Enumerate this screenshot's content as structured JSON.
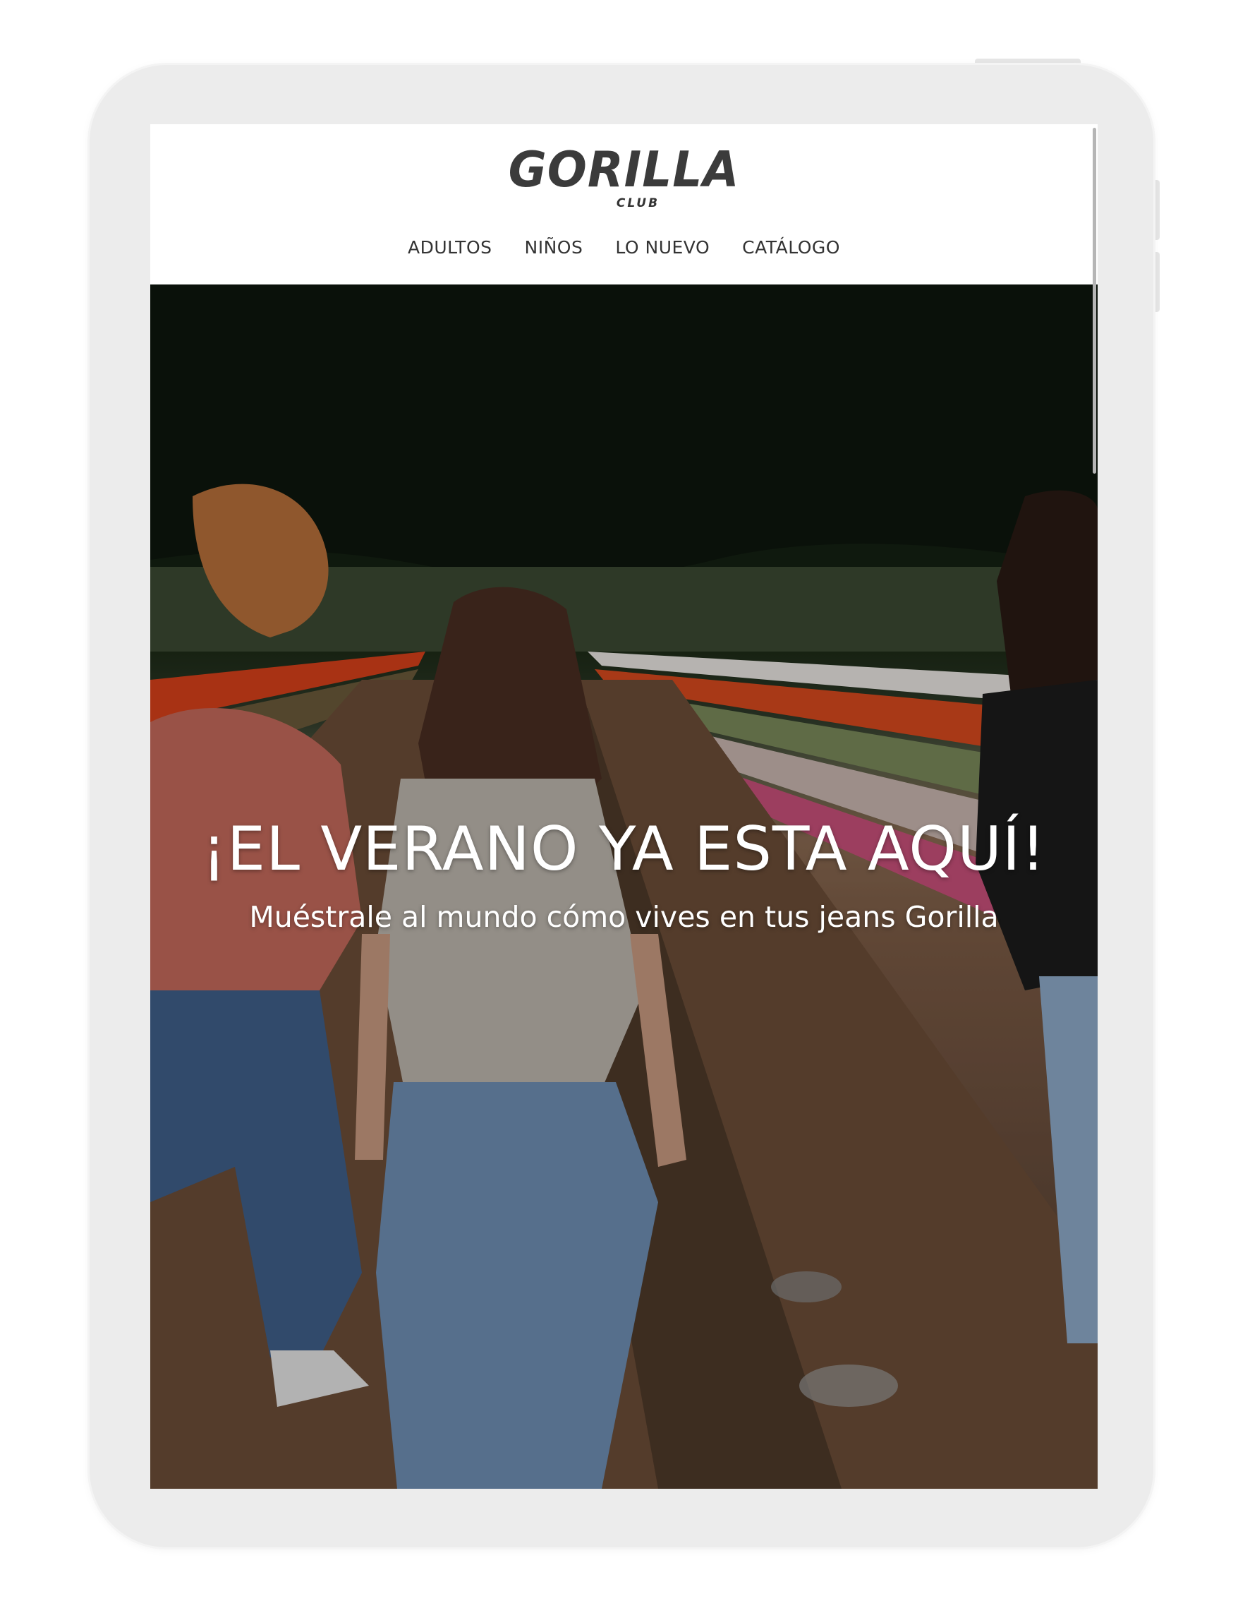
{
  "brand": {
    "name": "GORILLA",
    "sub": "CLUB"
  },
  "nav": {
    "items": [
      {
        "label": "ADULTOS"
      },
      {
        "label": "NIÑOS"
      },
      {
        "label": "LO NUEVO"
      },
      {
        "label": "CATÁLOGO"
      }
    ]
  },
  "hero": {
    "title": "¡EL VERANO YA ESTA AQUÍ!",
    "subtitle": "Muéstrale al mundo cómo vives en tus jeans Gorilla",
    "image": "photo of three women in jeans walking through a tulip field"
  },
  "colors": {
    "text_dark": "#333333",
    "device_frame": "#ececec",
    "hero_text": "#ffffff"
  }
}
